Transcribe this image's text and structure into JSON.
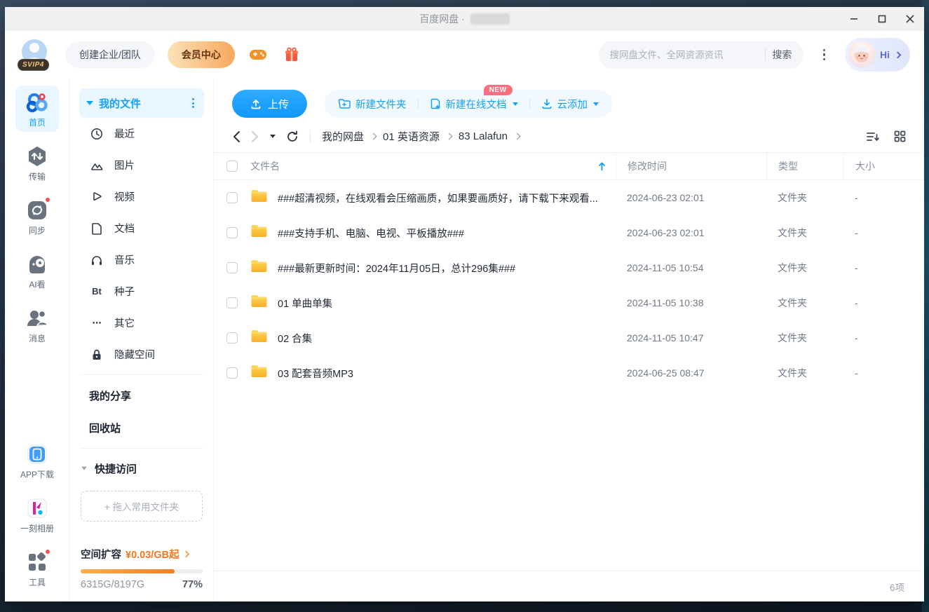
{
  "window": {
    "title": "百度网盘 ·"
  },
  "header": {
    "svip_badge": "SVIP4",
    "create_team_label": "创建企业/团队",
    "vip_center_label": "会员中心",
    "search": {
      "placeholder": "搜网盘文件、全网资源资讯",
      "button": "搜索"
    },
    "greeting": "Hi"
  },
  "nav_rail": {
    "items": [
      {
        "label": "首页",
        "active": true
      },
      {
        "label": "传输",
        "active": false
      },
      {
        "label": "同步",
        "active": false,
        "badge": true
      },
      {
        "label": "AI看",
        "active": false
      },
      {
        "label": "消息",
        "active": false
      }
    ],
    "bottom_items": [
      {
        "label": "APP下载"
      },
      {
        "label": "一刻相册"
      },
      {
        "label": "工具",
        "badge": true
      }
    ]
  },
  "sidebar": {
    "my_files_label": "我的文件",
    "categories": [
      {
        "label": "最近"
      },
      {
        "label": "图片"
      },
      {
        "label": "视频"
      },
      {
        "label": "文档"
      },
      {
        "label": "音乐"
      },
      {
        "label": "种子"
      },
      {
        "label": "其它"
      },
      {
        "label": "隐藏空间"
      }
    ],
    "links": {
      "my_share": "我的分享",
      "recycle_bin": "回收站"
    },
    "quick_access_label": "快捷访问",
    "drop_hint": "+ 拖入常用文件夹",
    "storage": {
      "expand_label": "空间扩容",
      "price": "¥0.03/GB起",
      "usage": "6315G/8197G",
      "percent_text": "77%",
      "percent_value": 77
    }
  },
  "toolbar": {
    "upload_label": "上传",
    "new_folder_label": "新建文件夹",
    "new_doc_label": "新建在线文档",
    "new_badge": "NEW",
    "cloud_add_label": "云添加"
  },
  "breadcrumb": {
    "items": [
      "我的网盘",
      "01 英语资源",
      "83 Lalafun"
    ]
  },
  "file_table": {
    "columns": {
      "name": "文件名",
      "modified": "修改时间",
      "type": "类型",
      "size": "大小"
    },
    "rows": [
      {
        "name": "###超清视频，在线观看会压缩画质，如果要画质好，请下载下来观看...",
        "modified": "2024-06-23 02:01",
        "type": "文件夹",
        "size": "-"
      },
      {
        "name": "###支持手机、电脑、电视、平板播放###",
        "modified": "2024-06-23 02:01",
        "type": "文件夹",
        "size": "-"
      },
      {
        "name": "###最新更新时间：2024年11月05日，总计296集###",
        "modified": "2024-11-05 10:54",
        "type": "文件夹",
        "size": "-"
      },
      {
        "name": "01 单曲单集",
        "modified": "2024-11-05 10:38",
        "type": "文件夹",
        "size": "-"
      },
      {
        "name": "02 合集",
        "modified": "2024-11-05 10:47",
        "type": "文件夹",
        "size": "-"
      },
      {
        "name": "03 配套音频MP3",
        "modified": "2024-06-25 08:47",
        "type": "文件夹",
        "size": "-"
      }
    ]
  },
  "footer": {
    "item_count": "6项"
  },
  "icons": {
    "bt_glyph": "Bt",
    "ellipsis_glyph": "⋯"
  },
  "colors": {
    "accent_blue": "#14a0f8",
    "vip_gradient_start": "#fbe2b8",
    "vip_gradient_end": "#f8a85c",
    "folder_yellow": "#fbc433",
    "storage_orange": "#ee8026",
    "badge_red": "#f4504d",
    "new_badge_pink": "#fb7080"
  }
}
